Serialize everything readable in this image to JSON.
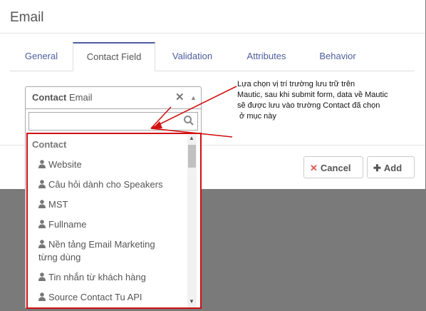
{
  "modal": {
    "title": "Email"
  },
  "tabs": [
    {
      "label": "General"
    },
    {
      "label": "Contact Field"
    },
    {
      "label": "Validation"
    },
    {
      "label": "Attributes"
    },
    {
      "label": "Behavior"
    }
  ],
  "active_tab": "Contact Field",
  "select": {
    "group": "Contact",
    "value": "Email"
  },
  "search": {
    "placeholder": ""
  },
  "dropdown": {
    "group_label": "Contact",
    "items": [
      {
        "label": "Website"
      },
      {
        "label": "Câu hỏi dành cho Speakers"
      },
      {
        "label": "MST"
      },
      {
        "label": "Fullname"
      },
      {
        "label": "Nền tảng Email Marketing từng dùng"
      },
      {
        "label": "Tin nhắn từ khách hàng"
      },
      {
        "label": "Source Contact Tu API"
      }
    ]
  },
  "buttons": {
    "cancel": "Cancel",
    "add": "Add"
  },
  "annotation": {
    "lines": [
      "Lựa chọn vị trí trường lưu trữ trên",
      "Mautic, sau khi submit form, data về Mautic",
      "sẽ được lưu vào trường Contact đã chọn",
      " ở mục này"
    ]
  },
  "colors": {
    "accent": "#4e5e9e",
    "annotation_red": "#d01010",
    "cancel_red": "#d9534f",
    "overlay": "#7a7a7a"
  },
  "icons": {
    "user": "user-icon",
    "search": "search-icon",
    "clear": "times-icon",
    "caret": "caret-up-icon",
    "cancel": "times-icon",
    "add": "plus-icon"
  }
}
